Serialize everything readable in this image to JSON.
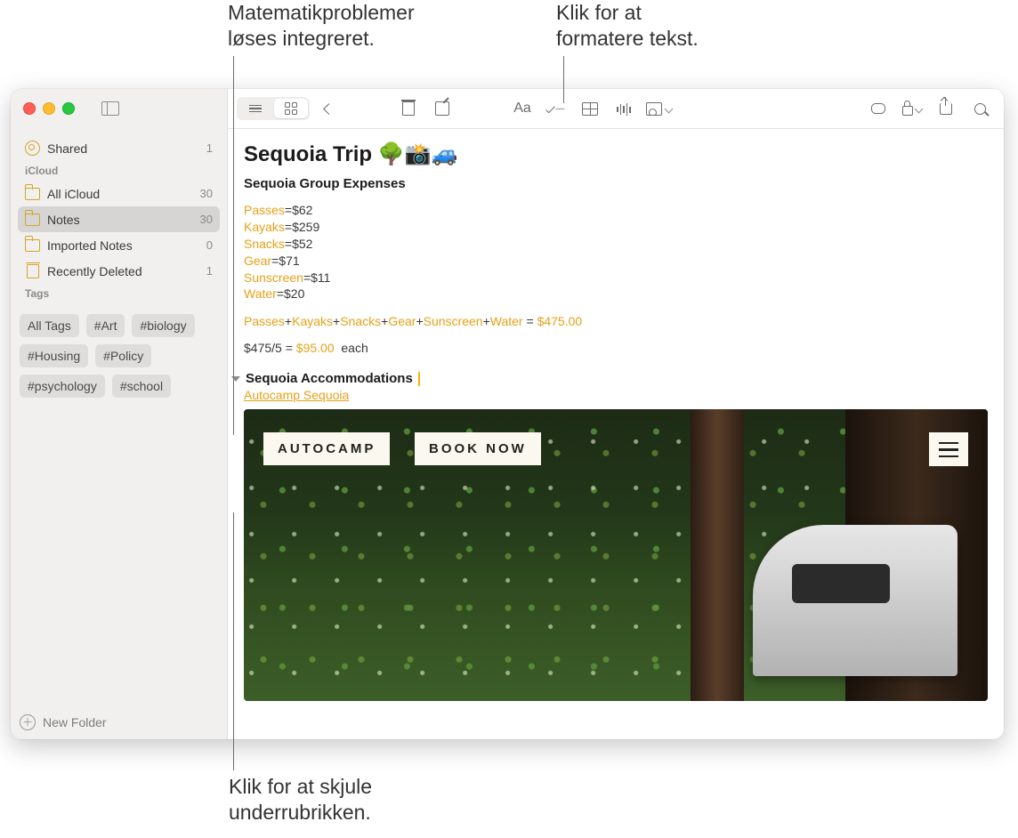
{
  "callouts": {
    "top_left": "Matematikproblemer\nløses integreret.",
    "top_right": "Klik for at\nformatere tekst.",
    "bottom": "Klik for at skjule\nunderrubrikken."
  },
  "sidebar": {
    "shared": {
      "label": "Shared",
      "count": "1"
    },
    "sections": {
      "icloud": {
        "title": "iCloud",
        "items": [
          {
            "label": "All iCloud",
            "count": "30"
          },
          {
            "label": "Notes",
            "count": "30"
          },
          {
            "label": "Imported Notes",
            "count": "0"
          },
          {
            "label": "Recently Deleted",
            "count": "1"
          }
        ]
      },
      "tags": {
        "title": "Tags",
        "items": [
          "All Tags",
          "#Art",
          "#biology",
          "#Housing",
          "#Policy",
          "#psychology",
          "#school"
        ]
      }
    },
    "new_folder": "New Folder"
  },
  "toolbar": {
    "format_label": "Aa"
  },
  "note": {
    "title": "Sequoia Trip 🌳📸🚙",
    "subtitle": "Sequoia Group Expenses",
    "expenses": [
      {
        "name": "Passes",
        "value": "$62"
      },
      {
        "name": "Kayaks",
        "value": "$259"
      },
      {
        "name": "Snacks",
        "value": "$52"
      },
      {
        "name": "Gear",
        "value": "$71"
      },
      {
        "name": "Sunscreen",
        "value": "$11"
      },
      {
        "name": "Water",
        "value": "$20"
      }
    ],
    "sum": {
      "vars": [
        "Passes",
        "Kayaks",
        "Snacks",
        "Gear",
        "Sunscreen",
        "Water"
      ],
      "result": "$475.00"
    },
    "per_person": {
      "expr": "$475/5 =",
      "result": "$95.00",
      "suffix": "each"
    },
    "section2": "Sequoia Accommodations",
    "link": "Autocamp Sequoia",
    "attachment_buttons": {
      "a": "AUTOCAMP",
      "b": "BOOK NOW"
    }
  },
  "accent": "#e6a117"
}
